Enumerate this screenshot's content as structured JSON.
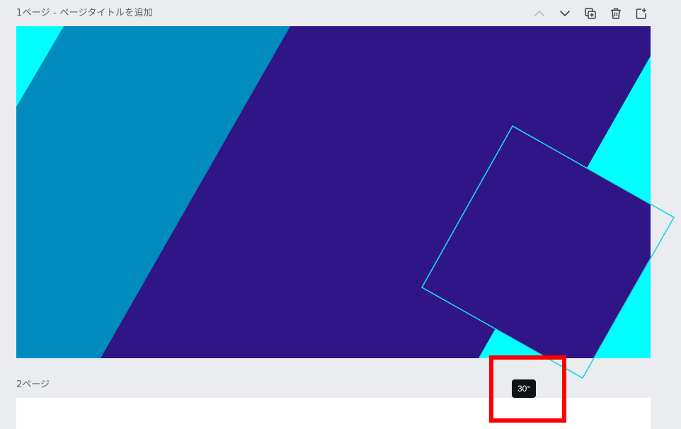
{
  "page1": {
    "title": "1ページ - ページタイトルを追加",
    "toolbar": {
      "move_up_icon": "chevron-up-icon",
      "move_down_icon": "chevron-down-icon",
      "duplicate_icon": "duplicate-page-icon",
      "delete_icon": "trash-icon",
      "add_page_icon": "add-page-icon"
    },
    "canvas": {
      "colors": {
        "background": "#00ffff",
        "band_light": "#008bbf",
        "band_dark": "#301586",
        "square_fill": "#301586",
        "square_outline": "#18d8e6"
      }
    }
  },
  "page2": {
    "title": "2ページ",
    "background": "#ffffff"
  },
  "rotation_tooltip": {
    "value": "30°"
  },
  "annotation": {
    "highlight_color": "#ff0000"
  }
}
